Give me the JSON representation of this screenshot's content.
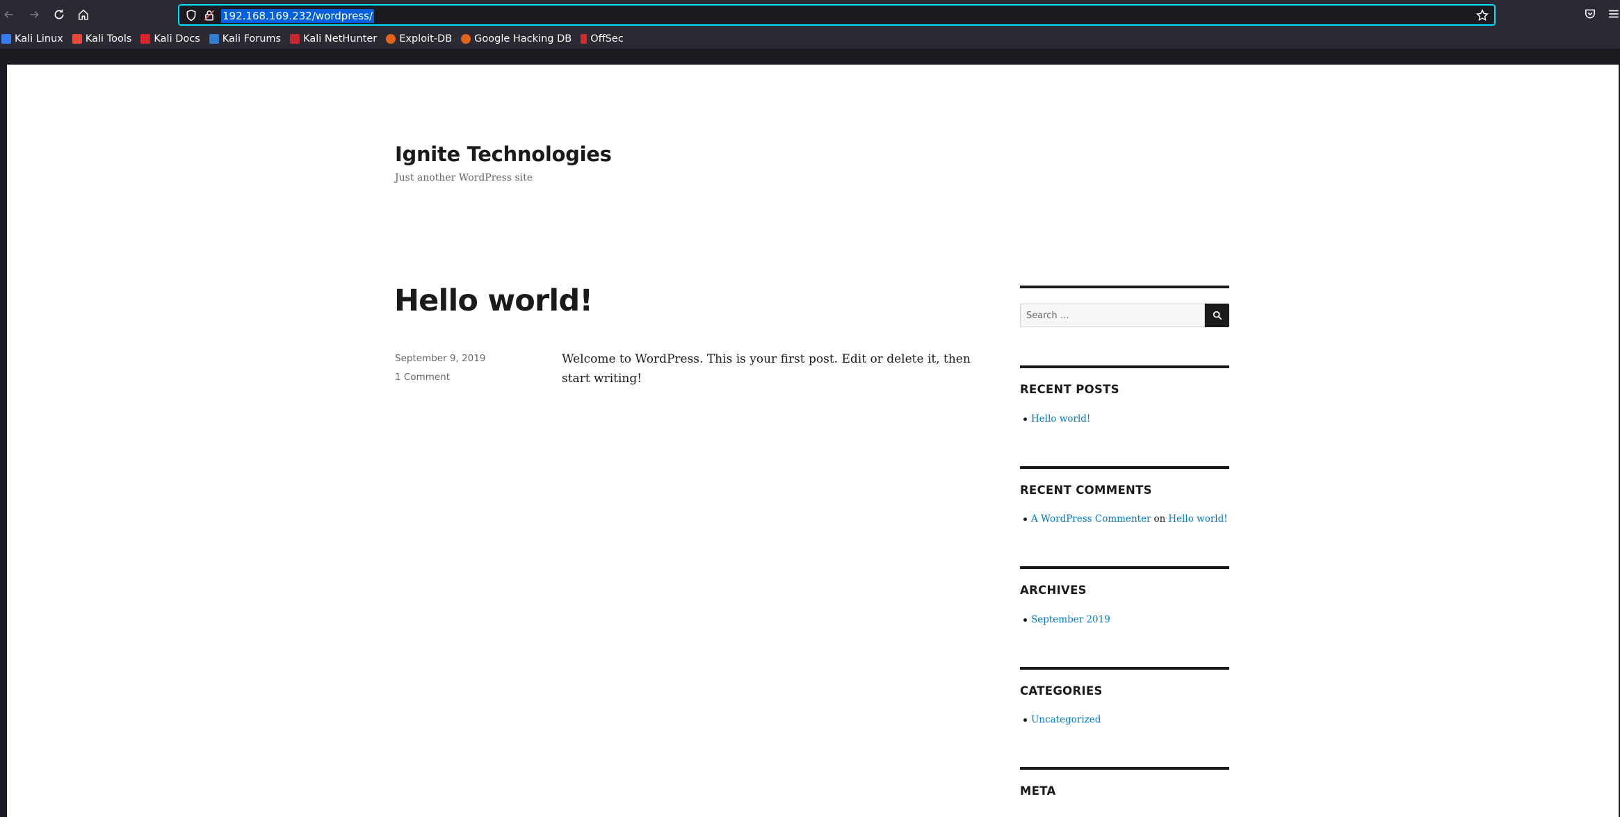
{
  "browser": {
    "url": "192.168.169.232/wordpress/",
    "bookmarks": [
      {
        "label": "Kali Linux",
        "color": "#367bf0"
      },
      {
        "label": "Kali Tools",
        "color": "#e8483c"
      },
      {
        "label": "Kali Docs",
        "color": "#d8232a"
      },
      {
        "label": "Kali Forums",
        "color": "#2f7bd6"
      },
      {
        "label": "Kali NetHunter",
        "color": "#c4262e"
      },
      {
        "label": "Exploit-DB",
        "color": "#e2641b"
      },
      {
        "label": "Google Hacking DB",
        "color": "#e2641b"
      },
      {
        "label": "OffSec",
        "color": "#d62a2a"
      }
    ]
  },
  "site": {
    "title": "Ignite Technologies",
    "description": "Just another WordPress site"
  },
  "post": {
    "title": "Hello world!",
    "date": "September 9, 2019",
    "comments": "1 Comment",
    "body": "Welcome to WordPress. This is your first post. Edit or delete it, then start writing!"
  },
  "sidebar": {
    "search": {
      "placeholder": "Search …"
    },
    "recent_posts": {
      "title": "RECENT POSTS",
      "items": [
        "Hello world!"
      ]
    },
    "recent_comments": {
      "title": "RECENT COMMENTS",
      "author": "A WordPress Commenter",
      "on": "on",
      "post": "Hello world!"
    },
    "archives": {
      "title": "ARCHIVES",
      "items": [
        "September 2019"
      ]
    },
    "categories": {
      "title": "CATEGORIES",
      "items": [
        "Uncategorized"
      ]
    },
    "meta": {
      "title": "META"
    }
  },
  "colors": {
    "link": "#007acc",
    "url_highlight": "#0060df",
    "focus_ring": "#00ddff"
  }
}
